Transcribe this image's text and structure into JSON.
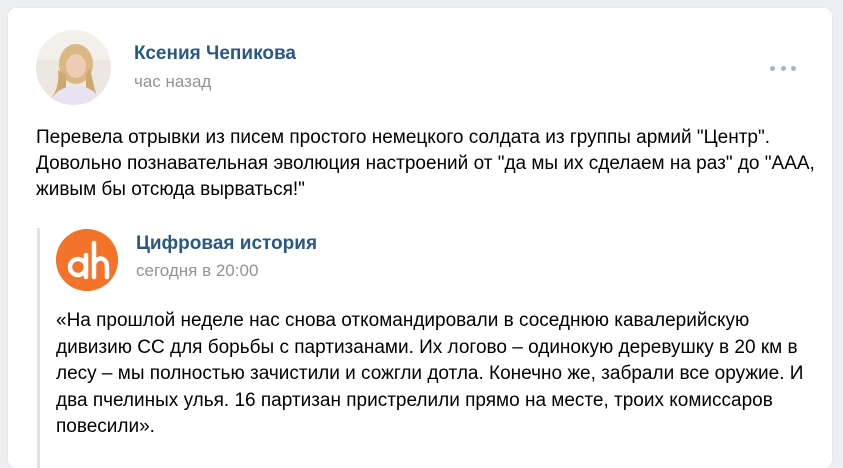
{
  "post": {
    "author": "Ксения Чепикова",
    "time": "час назад",
    "text": "Перевела отрывки из писем простого немецкого солдата из группы армий \"Центр\". Довольно познавательная эволюция настроений от \"да мы их сделаем на раз\" до \"ААА, живым бы отсюда вырваться!\""
  },
  "repost": {
    "source_name": "Цифровая история",
    "time": "сегодня в 20:00",
    "text": "«На прошлой неделе нас снова откомандировали в соседнюю кавалерийскую дивизию СС для борьбы с партизанами. Их логово – одинокую деревушку в 20 км в лесу – мы полностью зачистили и сожгли дотла. Конечно же, забрали все оружие. И два пчелиных улья. 16 партизан пристрелили прямо на месте, троих комиссаров повесили»."
  },
  "icons": {
    "more": "more-horizontal-icon",
    "source_logo": "dh-logo"
  },
  "colors": {
    "link": "#2a5885",
    "muted": "#939393",
    "logo_orange": "#f4732a",
    "repost_bar": "#dfe3e8"
  }
}
